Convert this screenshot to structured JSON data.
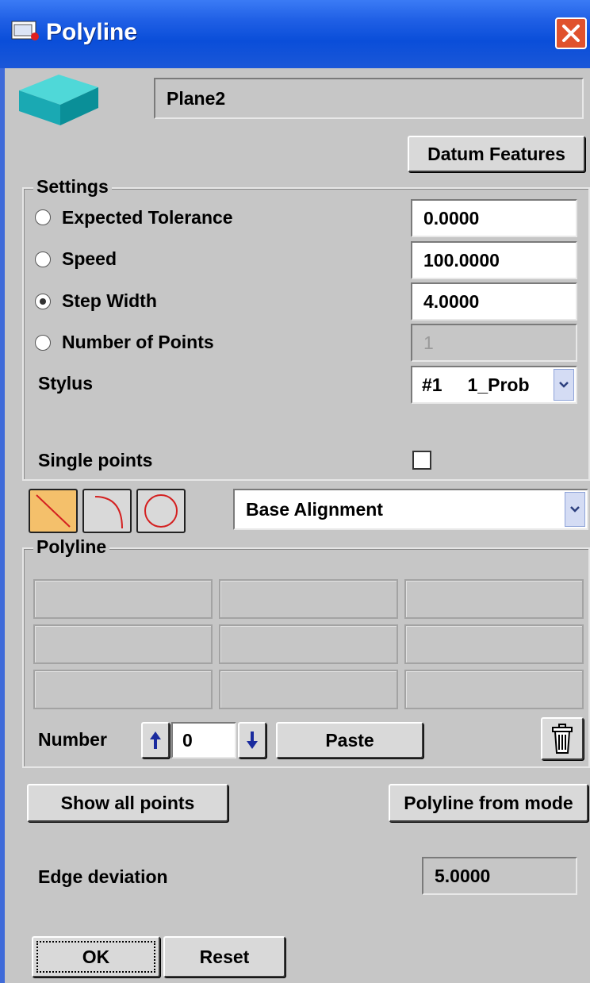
{
  "window": {
    "title": "Polyline",
    "accent": "#1f5fe5"
  },
  "feature": {
    "icon": "plane-feature-icon",
    "name": "Plane2"
  },
  "buttons": {
    "datum_features": "Datum Features",
    "paste": "Paste",
    "show_all_points": "Show all points",
    "polyline_from_model": "Polyline from mode",
    "ok": "OK",
    "reset": "Reset"
  },
  "settings": {
    "title": "Settings",
    "expected_tolerance": {
      "label": "Expected Tolerance",
      "value": "0.0000",
      "selected": false
    },
    "speed": {
      "label": "Speed",
      "value": "100.0000",
      "selected": false
    },
    "step_width": {
      "label": "Step Width",
      "value": "4.0000",
      "selected": true
    },
    "number_of_points": {
      "label": "Number of Points",
      "value": "1",
      "selected": false
    },
    "stylus": {
      "label": "Stylus",
      "value": "#1     1_Prob"
    },
    "single_points": {
      "label": "Single points",
      "checked": false
    }
  },
  "segment_tools": [
    "line-segment-icon",
    "arc-segment-icon",
    "circle-segment-icon"
  ],
  "alignment": {
    "value": "Base Alignment"
  },
  "polyline": {
    "title": "Polyline",
    "grid_rows": 3,
    "grid_cols": 3,
    "number_label": "Number",
    "number_value": "0"
  },
  "edge_deviation": {
    "label": "Edge deviation",
    "value": "5.0000"
  }
}
